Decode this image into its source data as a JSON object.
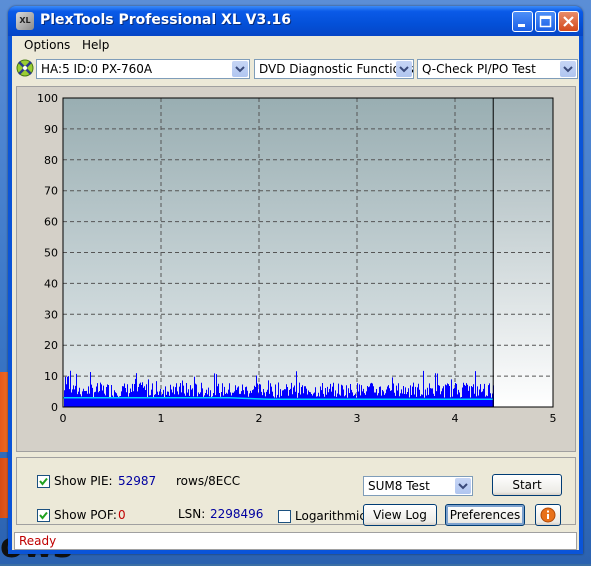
{
  "window": {
    "title": "PlexTools Professional XL V3.16",
    "app_icon_text": "XL"
  },
  "menu": {
    "options": "Options",
    "help": "Help"
  },
  "toolbar": {
    "drive": "HA:5 ID:0  PX-760A",
    "function": "DVD Diagnostic Functions",
    "test": "Q-Check PI/PO Test"
  },
  "chart_data": {
    "type": "bar",
    "title": "",
    "xlabel": "",
    "ylabel": "",
    "xlim": [
      0,
      5
    ],
    "ylim": [
      0,
      100
    ],
    "x_ticks": [
      "0",
      "1",
      "2",
      "3",
      "4",
      "5"
    ],
    "y_ticks": [
      "0",
      "10",
      "20",
      "30",
      "40",
      "50",
      "60",
      "70",
      "80",
      "90",
      "100"
    ],
    "data_end_x": 4.39,
    "grid": true,
    "series": [
      {
        "name": "PIE",
        "color": "#0000ff",
        "typical_range": [
          3,
          12
        ],
        "peak": 12
      },
      {
        "name": "SUM8",
        "color": "#00d0ff",
        "x": [
          0,
          1.7,
          2.1,
          4.39
        ],
        "values": [
          3,
          3,
          2.5,
          2.5
        ]
      }
    ]
  },
  "controls": {
    "show_pie_label": "Show PIE:",
    "show_pie_checked": true,
    "pie_value": "52987",
    "pie_unit": "rows/8ECC",
    "show_pof_label": "Show POF:",
    "show_pof_checked": true,
    "pof_value": "0",
    "lsn_label": "LSN:",
    "lsn_value": "2298496",
    "logarithmic_label": "Logarithmic",
    "logarithmic_checked": false,
    "test_select": "SUM8 Test",
    "start_button": "Start",
    "view_log_button": "View Log",
    "preferences_button": "Preferences"
  },
  "status": {
    "text": "Ready"
  },
  "desktop": {
    "text": "ows"
  },
  "colors": {
    "pie_bars": "#0000ff",
    "sum8_line": "#00d0ff",
    "status_text": "#c00000",
    "value_blue": "#0000a0"
  }
}
